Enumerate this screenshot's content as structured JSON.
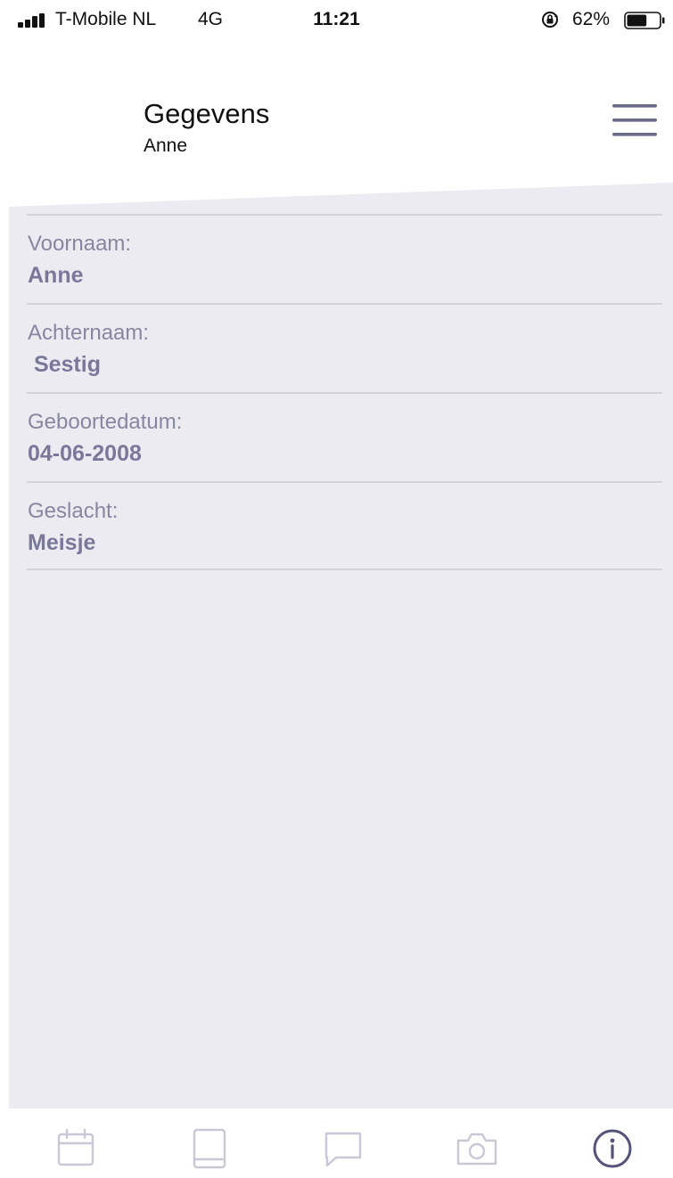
{
  "status_bar": {
    "carrier": "T-Mobile NL",
    "network": "4G",
    "time": "11:21",
    "battery": "62%",
    "battery_level": 0.62,
    "icons": [
      "signal-icon",
      "rotation-lock-icon",
      "battery-icon"
    ]
  },
  "header": {
    "title": "Gegevens",
    "subtitle": "Anne",
    "menu_icon": "hamburger-menu-icon"
  },
  "fields": [
    {
      "label": "Voornaam:",
      "value": "Anne"
    },
    {
      "label": "Achternaam:",
      "value": " Sestig"
    },
    {
      "label": "Geboortedatum:",
      "value": "04-06-2008"
    },
    {
      "label": "Geslacht:",
      "value": "Meisje"
    }
  ],
  "tab_bar": {
    "tabs": [
      {
        "icon": "calendar-icon"
      },
      {
        "icon": "book-icon"
      },
      {
        "icon": "chat-icon"
      },
      {
        "icon": "camera-icon"
      },
      {
        "icon": "info-icon",
        "active": true
      }
    ]
  },
  "colors": {
    "panel_background": "#ebebf1",
    "label_text": "#8886a0",
    "value_text": "#7a779a",
    "icon_inactive": "#c9c8d6",
    "icon_active": "#56537a"
  }
}
